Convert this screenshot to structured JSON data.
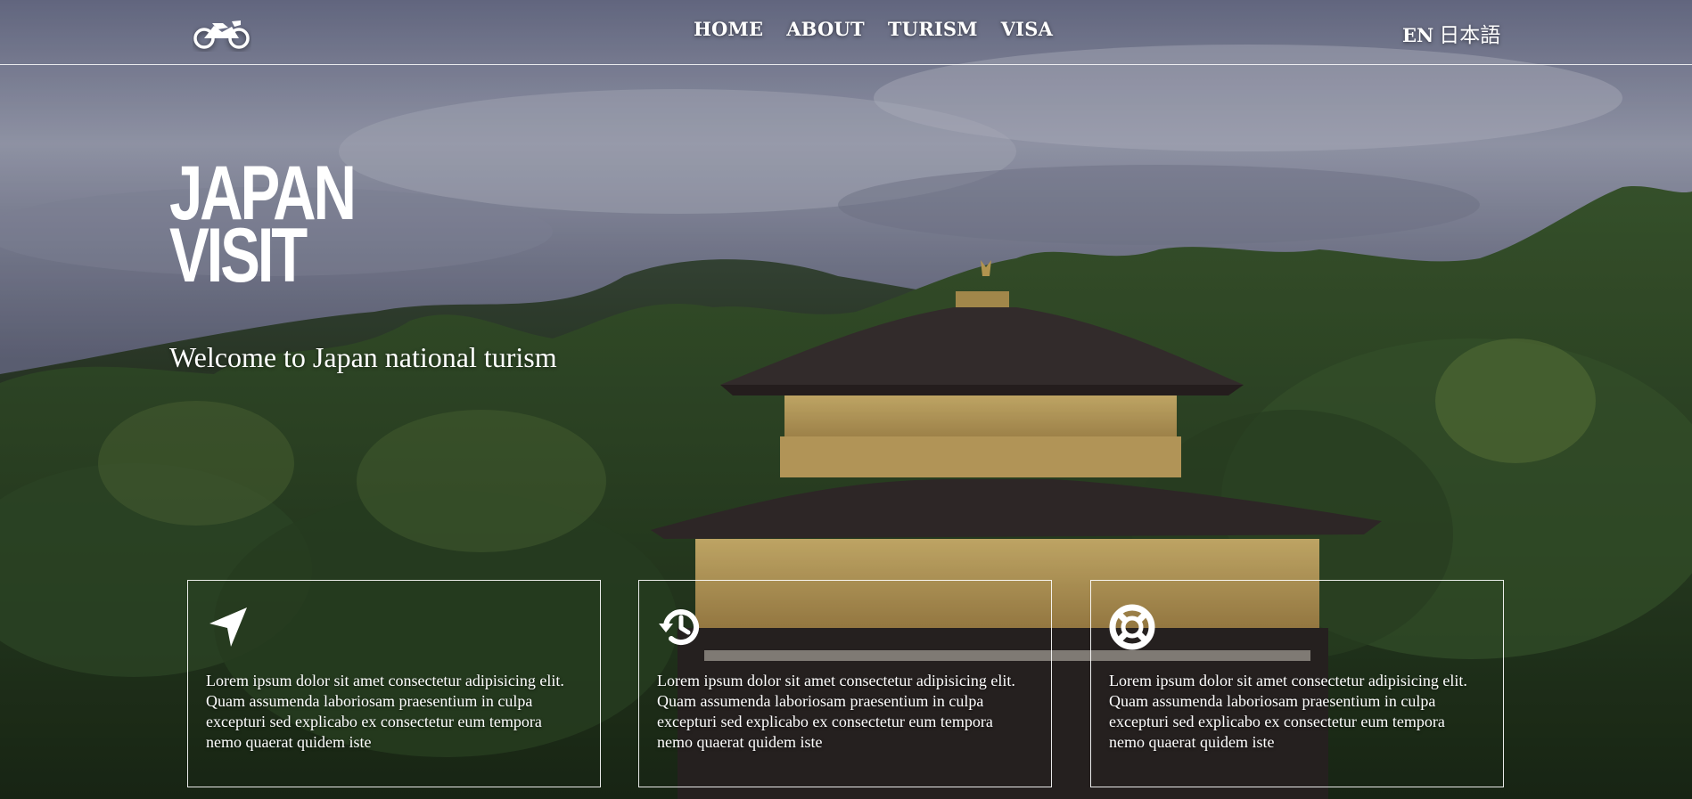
{
  "header": {
    "nav": [
      "HOME",
      "ABOUT",
      "TURISM",
      "VISA"
    ],
    "lang_en": "EN",
    "lang_ja": "日本語"
  },
  "hero": {
    "title_line1": "JAPAN",
    "title_line2": "VISIT",
    "subtitle": "Welcome to Japan national turism"
  },
  "cards": [
    {
      "icon": "location-arrow-icon",
      "text": "Lorem ipsum dolor sit amet consectetur adipisicing elit. Quam assumenda laboriosam praesentium in culpa excepturi sed explicabo ex consectetur eum tempora nemo quaerat quidem iste"
    },
    {
      "icon": "history-icon",
      "text": "Lorem ipsum dolor sit amet consectetur adipisicing elit. Quam assumenda laboriosam praesentium in culpa excepturi sed explicabo ex consectetur eum tempora nemo quaerat quidem iste"
    },
    {
      "icon": "life-ring-icon",
      "text": "Lorem ipsum dolor sit amet consectetur adipisicing elit. Quam assumenda laboriosam praesentium in culpa excepturi sed explicabo ex consectetur eum tempora nemo quaerat quidem iste"
    }
  ],
  "colors": {
    "sky": "#8a8fa6",
    "forest": "#2f4a2a",
    "gold": "#c6a55c",
    "roof": "#3a3131",
    "text": "#ffffff"
  }
}
